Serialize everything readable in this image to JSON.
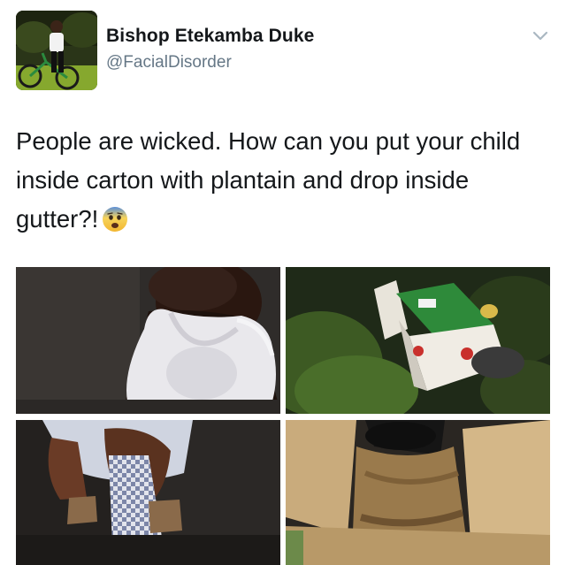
{
  "user": {
    "display_name": "Bishop Etekamba Duke",
    "handle": "@FacialDisorder"
  },
  "tweet": {
    "text": "People are wicked. How can you put your child inside carton with plantain and drop inside gutter?!",
    "emoji": "fearful-face"
  },
  "menu": {
    "icon": "chevron-down-icon"
  },
  "media": [
    {
      "name": "photo-child-in-vest"
    },
    {
      "name": "photo-carton-in-bush"
    },
    {
      "name": "photo-child-legs-sandals"
    },
    {
      "name": "photo-open-carton"
    }
  ],
  "colors": {
    "text": "#14171a",
    "secondary": "#657786",
    "chevron": "#aab8c2"
  }
}
